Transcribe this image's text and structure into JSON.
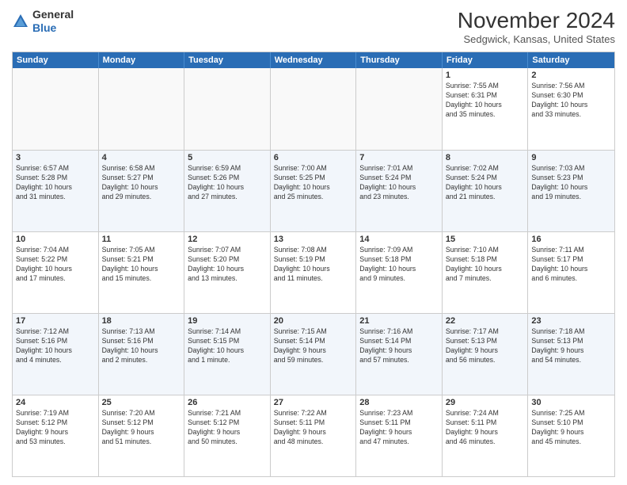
{
  "logo": {
    "line1": "General",
    "line2": "Blue"
  },
  "header": {
    "title": "November 2024",
    "location": "Sedgwick, Kansas, United States"
  },
  "weekdays": [
    "Sunday",
    "Monday",
    "Tuesday",
    "Wednesday",
    "Thursday",
    "Friday",
    "Saturday"
  ],
  "weeks": [
    [
      {
        "day": "",
        "info": ""
      },
      {
        "day": "",
        "info": ""
      },
      {
        "day": "",
        "info": ""
      },
      {
        "day": "",
        "info": ""
      },
      {
        "day": "",
        "info": ""
      },
      {
        "day": "1",
        "info": "Sunrise: 7:55 AM\nSunset: 6:31 PM\nDaylight: 10 hours\nand 35 minutes."
      },
      {
        "day": "2",
        "info": "Sunrise: 7:56 AM\nSunset: 6:30 PM\nDaylight: 10 hours\nand 33 minutes."
      }
    ],
    [
      {
        "day": "3",
        "info": "Sunrise: 6:57 AM\nSunset: 5:28 PM\nDaylight: 10 hours\nand 31 minutes."
      },
      {
        "day": "4",
        "info": "Sunrise: 6:58 AM\nSunset: 5:27 PM\nDaylight: 10 hours\nand 29 minutes."
      },
      {
        "day": "5",
        "info": "Sunrise: 6:59 AM\nSunset: 5:26 PM\nDaylight: 10 hours\nand 27 minutes."
      },
      {
        "day": "6",
        "info": "Sunrise: 7:00 AM\nSunset: 5:25 PM\nDaylight: 10 hours\nand 25 minutes."
      },
      {
        "day": "7",
        "info": "Sunrise: 7:01 AM\nSunset: 5:24 PM\nDaylight: 10 hours\nand 23 minutes."
      },
      {
        "day": "8",
        "info": "Sunrise: 7:02 AM\nSunset: 5:24 PM\nDaylight: 10 hours\nand 21 minutes."
      },
      {
        "day": "9",
        "info": "Sunrise: 7:03 AM\nSunset: 5:23 PM\nDaylight: 10 hours\nand 19 minutes."
      }
    ],
    [
      {
        "day": "10",
        "info": "Sunrise: 7:04 AM\nSunset: 5:22 PM\nDaylight: 10 hours\nand 17 minutes."
      },
      {
        "day": "11",
        "info": "Sunrise: 7:05 AM\nSunset: 5:21 PM\nDaylight: 10 hours\nand 15 minutes."
      },
      {
        "day": "12",
        "info": "Sunrise: 7:07 AM\nSunset: 5:20 PM\nDaylight: 10 hours\nand 13 minutes."
      },
      {
        "day": "13",
        "info": "Sunrise: 7:08 AM\nSunset: 5:19 PM\nDaylight: 10 hours\nand 11 minutes."
      },
      {
        "day": "14",
        "info": "Sunrise: 7:09 AM\nSunset: 5:18 PM\nDaylight: 10 hours\nand 9 minutes."
      },
      {
        "day": "15",
        "info": "Sunrise: 7:10 AM\nSunset: 5:18 PM\nDaylight: 10 hours\nand 7 minutes."
      },
      {
        "day": "16",
        "info": "Sunrise: 7:11 AM\nSunset: 5:17 PM\nDaylight: 10 hours\nand 6 minutes."
      }
    ],
    [
      {
        "day": "17",
        "info": "Sunrise: 7:12 AM\nSunset: 5:16 PM\nDaylight: 10 hours\nand 4 minutes."
      },
      {
        "day": "18",
        "info": "Sunrise: 7:13 AM\nSunset: 5:16 PM\nDaylight: 10 hours\nand 2 minutes."
      },
      {
        "day": "19",
        "info": "Sunrise: 7:14 AM\nSunset: 5:15 PM\nDaylight: 10 hours\nand 1 minute."
      },
      {
        "day": "20",
        "info": "Sunrise: 7:15 AM\nSunset: 5:14 PM\nDaylight: 9 hours\nand 59 minutes."
      },
      {
        "day": "21",
        "info": "Sunrise: 7:16 AM\nSunset: 5:14 PM\nDaylight: 9 hours\nand 57 minutes."
      },
      {
        "day": "22",
        "info": "Sunrise: 7:17 AM\nSunset: 5:13 PM\nDaylight: 9 hours\nand 56 minutes."
      },
      {
        "day": "23",
        "info": "Sunrise: 7:18 AM\nSunset: 5:13 PM\nDaylight: 9 hours\nand 54 minutes."
      }
    ],
    [
      {
        "day": "24",
        "info": "Sunrise: 7:19 AM\nSunset: 5:12 PM\nDaylight: 9 hours\nand 53 minutes."
      },
      {
        "day": "25",
        "info": "Sunrise: 7:20 AM\nSunset: 5:12 PM\nDaylight: 9 hours\nand 51 minutes."
      },
      {
        "day": "26",
        "info": "Sunrise: 7:21 AM\nSunset: 5:12 PM\nDaylight: 9 hours\nand 50 minutes."
      },
      {
        "day": "27",
        "info": "Sunrise: 7:22 AM\nSunset: 5:11 PM\nDaylight: 9 hours\nand 48 minutes."
      },
      {
        "day": "28",
        "info": "Sunrise: 7:23 AM\nSunset: 5:11 PM\nDaylight: 9 hours\nand 47 minutes."
      },
      {
        "day": "29",
        "info": "Sunrise: 7:24 AM\nSunset: 5:11 PM\nDaylight: 9 hours\nand 46 minutes."
      },
      {
        "day": "30",
        "info": "Sunrise: 7:25 AM\nSunset: 5:10 PM\nDaylight: 9 hours\nand 45 minutes."
      }
    ]
  ]
}
